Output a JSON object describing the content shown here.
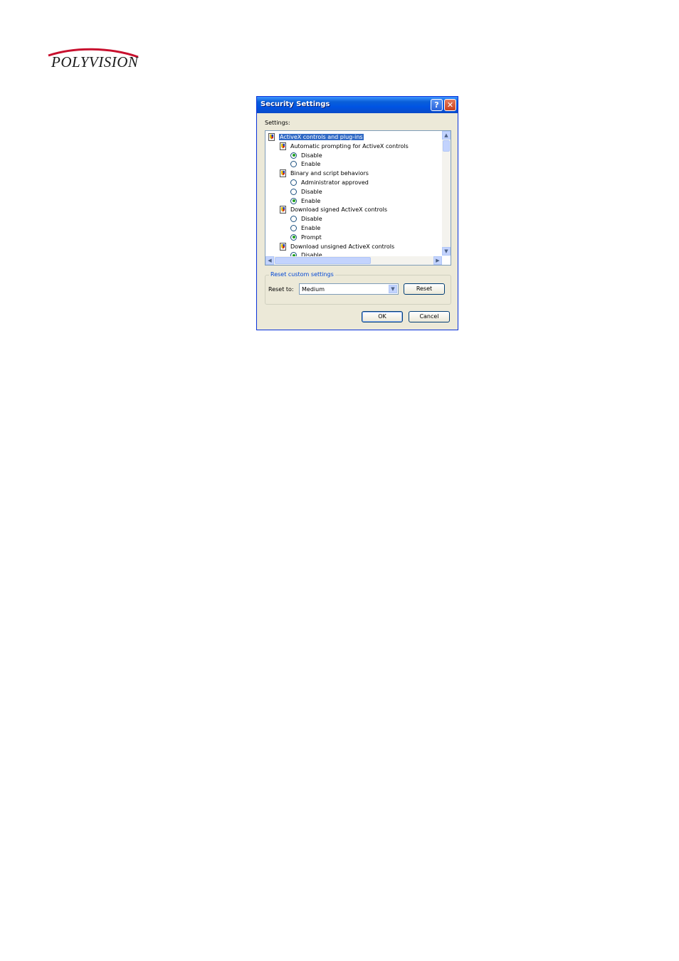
{
  "logo": {
    "text": "POLYVISION"
  },
  "dialog": {
    "title": "Security Settings",
    "help_glyph": "?",
    "close_glyph": "✕",
    "settings_label": "Settings:",
    "tree": [
      {
        "kind": "category",
        "icon": "shield-icon",
        "label": "ActiveX controls and plug-ins",
        "selected": true
      },
      {
        "kind": "setting",
        "icon": "shield-icon",
        "label": "Automatic prompting for ActiveX controls"
      },
      {
        "kind": "option",
        "label": "Disable",
        "checked": true
      },
      {
        "kind": "option",
        "label": "Enable",
        "checked": false
      },
      {
        "kind": "setting",
        "icon": "shield-icon",
        "label": "Binary and script behaviors"
      },
      {
        "kind": "option",
        "label": "Administrator approved",
        "checked": false
      },
      {
        "kind": "option",
        "label": "Disable",
        "checked": false
      },
      {
        "kind": "option",
        "label": "Enable",
        "checked": true
      },
      {
        "kind": "setting",
        "icon": "shield-icon",
        "label": "Download signed ActiveX controls"
      },
      {
        "kind": "option",
        "label": "Disable",
        "checked": false
      },
      {
        "kind": "option",
        "label": "Enable",
        "checked": false
      },
      {
        "kind": "option",
        "label": "Prompt",
        "checked": true
      },
      {
        "kind": "setting",
        "icon": "shield-icon",
        "label": "Download unsigned ActiveX controls"
      },
      {
        "kind": "option",
        "label": "Disable",
        "checked": true
      }
    ],
    "reset_group_title": "Reset custom settings",
    "reset_to_label": "Reset to:",
    "reset_to_value": "Medium",
    "reset_button": "Reset",
    "ok_button": "OK",
    "cancel_button": "Cancel",
    "scroll_up_glyph": "▲",
    "scroll_down_glyph": "▼",
    "scroll_left_glyph": "◀",
    "scroll_right_glyph": "▶",
    "dropdown_glyph": "▼"
  }
}
